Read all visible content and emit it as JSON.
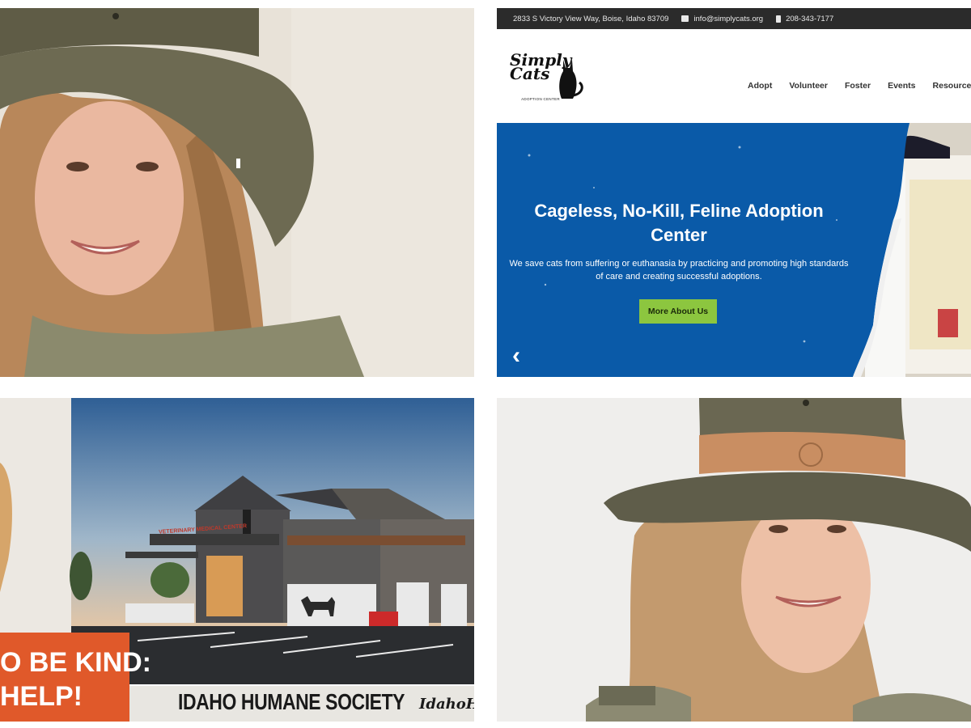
{
  "panels": {
    "portrait_top": {
      "description_icon": "person-portrait-icon"
    },
    "website": {
      "topbar": {
        "address": "2833 S Victory View Way, Boise, Idaho 83709",
        "email": "info@simplycats.org",
        "phone": "208-343-7177"
      },
      "logo": {
        "name": "Simply Cats",
        "subtitle": "ADOPTION CENTER"
      },
      "nav": [
        "Adopt",
        "Volunteer",
        "Foster",
        "Events",
        "Resources"
      ],
      "hero": {
        "title": "Cageless, No-Kill, Feline Adoption Center",
        "description": "We save cats from suffering or euthanasia by practicing and promoting high standards of care and creating successful adoptions.",
        "button": "More About Us",
        "prev_arrow": "‹"
      },
      "colors": {
        "topbar": "#2b2b2b",
        "hero_blue": "#0a5aa8",
        "button_green": "#8cc63f"
      }
    },
    "humane_society": {
      "building_sign": "VETERINARY MEDICAL CENTER",
      "banner_line1": "O BE KIND:",
      "banner_line2": "HELP!",
      "name": "IDAHO HUMANE SOCIETY",
      "url_partial": "IdahoH",
      "colors": {
        "banner": "#e0592a"
      }
    },
    "portrait_bottom": {
      "description_icon": "person-portrait-icon"
    }
  }
}
